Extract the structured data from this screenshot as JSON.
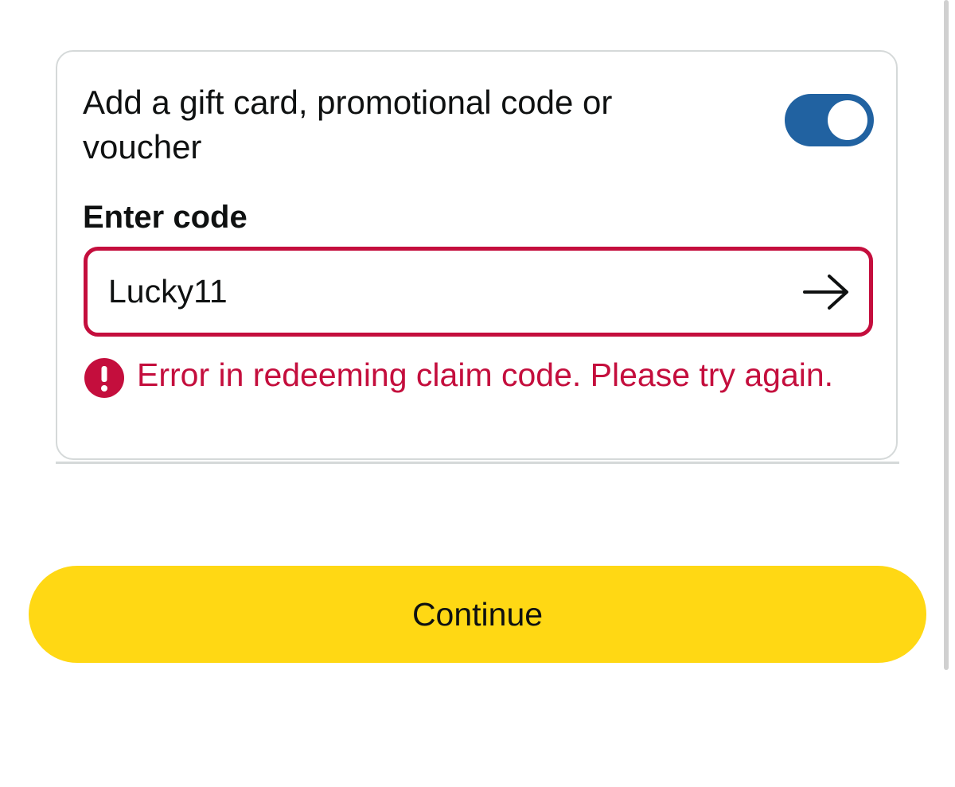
{
  "gift_card_section": {
    "toggle_label": "Add a gift card, promotional code or voucher",
    "toggle_on": true,
    "field_label": "Enter code",
    "code_value": "Lucky11",
    "submit_icon": "arrow-right-icon",
    "error_icon": "error-exclamation-icon",
    "error_message": "Error in redeeming claim code. Please try again."
  },
  "actions": {
    "continue_label": "Continue"
  },
  "colors": {
    "toggle_on": "#2162a1",
    "error": "#c40e3d",
    "continue_button": "#ffd814",
    "card_border": "#d5d9d9",
    "text": "#0f1111"
  }
}
